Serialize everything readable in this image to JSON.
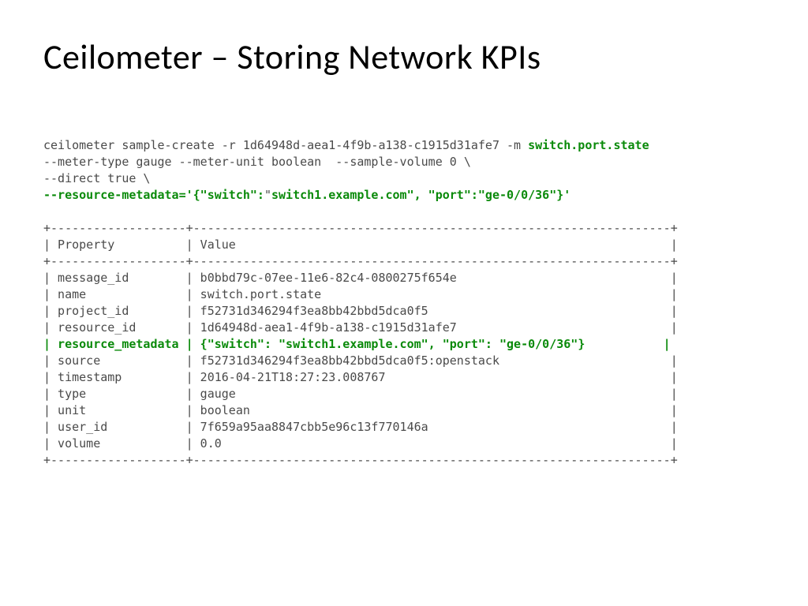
{
  "title": "Ceilometer – Storing Network KPIs",
  "cmd": {
    "line1a": "ceilometer sample-create -r 1d64948d-aea1-4f9b-a138-c1915d31afe7 -m ",
    "line1b": "switch.port.state",
    "line2": "--meter-type gauge --meter-unit boolean  --sample-volume 0 \\",
    "line3": "--direct true \\",
    "line4a": "--resource-metadata='{\"switch\":",
    "line4b": "\"",
    "line4c": "switch1.example.com\", \"port\":\"ge-0/0/36\"}'"
  },
  "table": {
    "border_top": "+-------------------+-------------------------------------------------------------------+",
    "header_prop": "| Property          ",
    "header_val": "| Value                                                             |",
    "border_mid": "+-------------------+-------------------------------------------------------------------+",
    "rows": [
      {
        "prop": "| message_id        ",
        "val": "| b0bbd79c-07ee-11e6-82c4-0800275f654e                              |",
        "hl": false
      },
      {
        "prop": "| name              ",
        "val": "| switch.port.state                                                 |",
        "hl": false
      },
      {
        "prop": "| project_id        ",
        "val": "| f52731d346294f3ea8bb42bbd5dca0f5                                  |",
        "hl": false
      },
      {
        "prop": "| resource_id       ",
        "val": "| 1d64948d-aea1-4f9b-a138-c1915d31afe7                              |",
        "hl": false
      },
      {
        "prop": "| resource_metadata ",
        "val": "| {\"switch\": \"switch1.example.com\", \"port\": \"ge-0/0/36\"}           |",
        "hl": true
      },
      {
        "prop": "| source            ",
        "val": "| f52731d346294f3ea8bb42bbd5dca0f5:openstack                        |",
        "hl": false
      },
      {
        "prop": "| timestamp         ",
        "val": "| 2016-04-21T18:27:23.008767                                        |",
        "hl": false
      },
      {
        "prop": "| type              ",
        "val": "| gauge                                                             |",
        "hl": false
      },
      {
        "prop": "| unit              ",
        "val": "| boolean                                                           |",
        "hl": false
      },
      {
        "prop": "| user_id           ",
        "val": "| 7f659a95aa8847cbb5e96c13f770146a                                  |",
        "hl": false
      },
      {
        "prop": "| volume            ",
        "val": "| 0.0                                                               |",
        "hl": false
      }
    ],
    "border_bot": "+-------------------+-------------------------------------------------------------------+"
  }
}
